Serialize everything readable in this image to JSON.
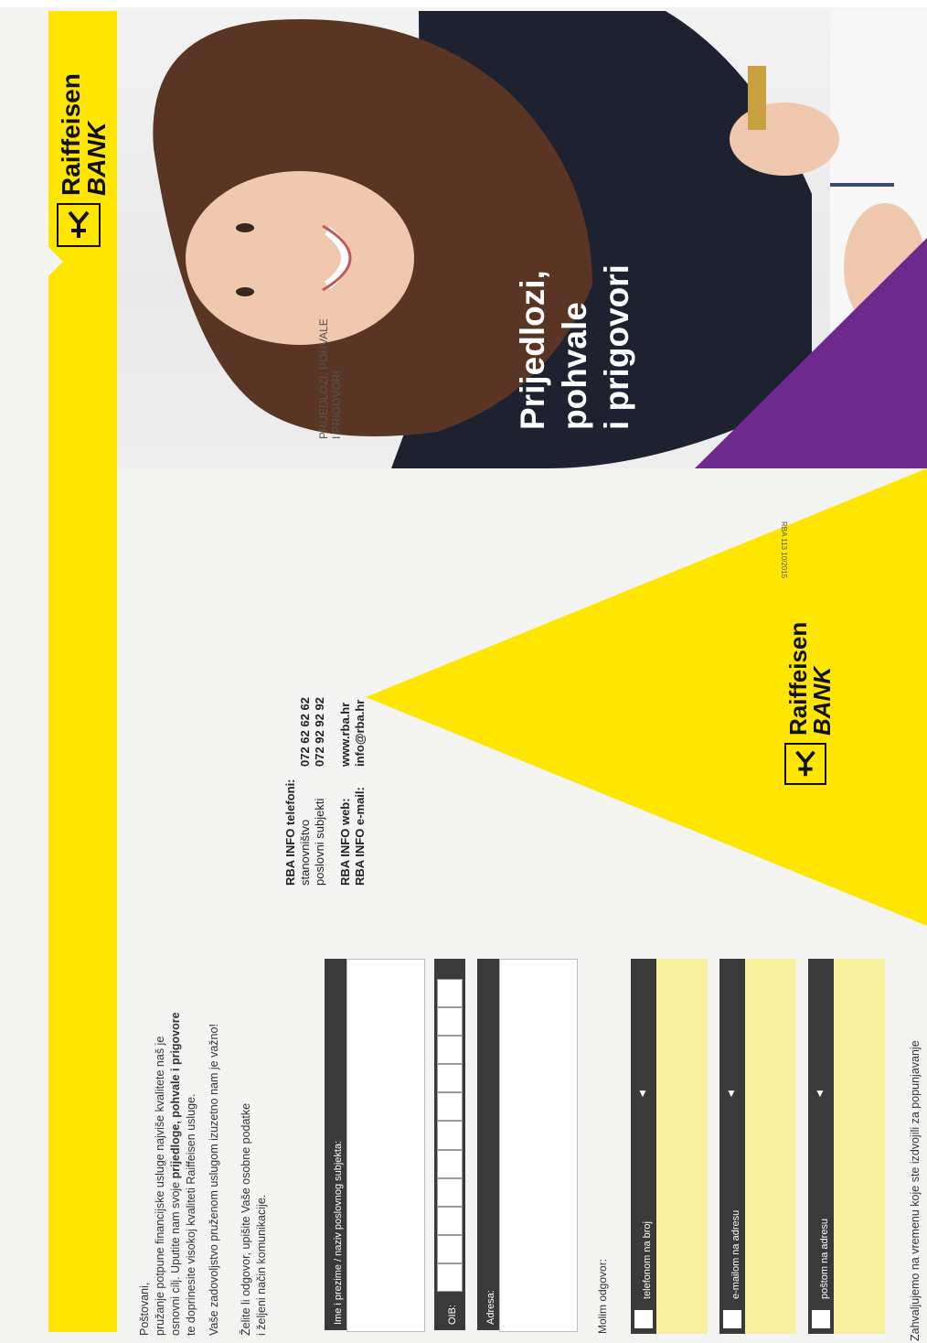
{
  "cover": {
    "header_label_line1": "PRIJEDLOZI, POHVALE",
    "header_label_line2": "I PRIGOVORI",
    "logo_line1": "Raiffeisen",
    "logo_line2": "BANK",
    "title_line1": "Prijedlozi,",
    "title_line2": "pohvale",
    "title_line3": "i prigovori"
  },
  "back": {
    "code": "RBA 113 10/2015",
    "logo_line1": "Raiffeisen",
    "logo_line2": "BANK",
    "info_heading": "RBA INFO telefoni:",
    "phone_rows": [
      {
        "label": "stanovništvo",
        "value": "072 62 62 62"
      },
      {
        "label": "poslovni subjekti",
        "value": "072 92 92 92"
      }
    ],
    "web_rows": [
      {
        "label": "RBA INFO web:",
        "value": "www.rba.hr"
      },
      {
        "label": "RBA INFO e-mail:",
        "value": "info@rba.hr"
      }
    ]
  },
  "form": {
    "greeting": "Poštovani,",
    "intro_line1": "pružanje potpune financijske usluge najviše kvalitete naš je",
    "intro_line2_pre": "osnovni cilj. Uputite nam svoje ",
    "intro_line2_bold": "prijedloge, pohvale i prigovore",
    "intro_line3": "te doprinesite visokoj kvaliteti Raiffeisen usluge.",
    "satisfaction": "Vaše zadovoljstvo pruženom uslugom izuzetno nam je važno!",
    "reply_line1": "Želite li odgovor, upišite Vaše osobne podatke",
    "reply_line2": "i željeni način komunikacije.",
    "name_label": "Ime i prezime / naziv poslovnog subjekta:",
    "oib_label": "OIB:",
    "address_label": "Adresa:",
    "reply_prompt": "Molim odgovor:",
    "options": [
      {
        "label": "telefonom na broj"
      },
      {
        "label": "e-mailom na adresu"
      },
      {
        "label": "poštom na adresu"
      }
    ],
    "footer": "Zahvaljujemo na vremenu koje ste izdvojili za popunjavanje"
  }
}
